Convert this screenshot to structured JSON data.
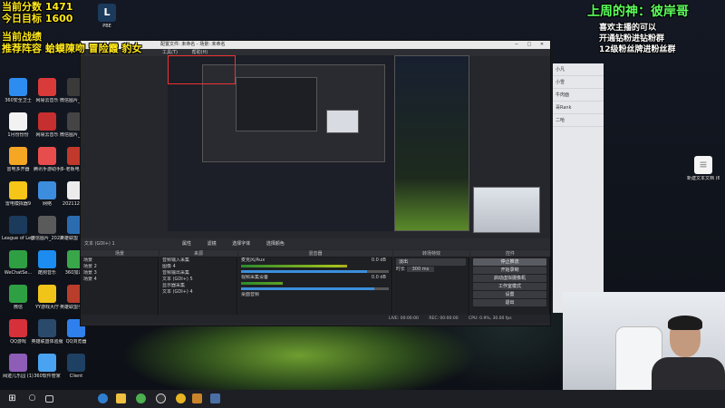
{
  "stream_overlay": {
    "score_line": "当前分数 1471",
    "goal_line": "今日目标 1600",
    "battle_line": "当前战绩",
    "recommend_line": "推荐阵容 蛤蟆陳吻 冒险霞 豹女",
    "god_line": "上周的神：彼岸哥",
    "promo": [
      "喜欢主播的可以",
      "开通钻粉进钻粉群",
      "12级粉丝牌进粉丝群"
    ]
  },
  "desktop_icons": [
    {
      "label": "360安全卫士",
      "icon": "shield-icon",
      "color": "#2d8cf0"
    },
    {
      "label": "网易云音乐",
      "icon": "music-icon",
      "color": "#d93a3a"
    },
    {
      "label": "微信图片_2022021...",
      "icon": "image-icon",
      "color": "#3a3a3a"
    },
    {
      "label": "1月份份份",
      "icon": "document-icon",
      "color": "#f2f2f2"
    },
    {
      "label": "网易云音乐",
      "icon": "netease-icon",
      "color": "#c62f2f"
    },
    {
      "label": "微信图片_2022020...",
      "icon": "image-icon",
      "color": "#444"
    },
    {
      "label": "雷电多开器",
      "icon": "thunder-icon",
      "color": "#f5a623"
    },
    {
      "label": "腾讯手游助手",
      "icon": "tencent-icon",
      "color": "#e84d4d"
    },
    {
      "label": "多·老板电竞助手",
      "icon": "gamepad-icon",
      "color": "#c0392b"
    },
    {
      "label": "雷电模拟器9",
      "icon": "android-icon",
      "color": "#f5c518"
    },
    {
      "label": "网络",
      "icon": "network-icon",
      "color": "#3c8dde"
    },
    {
      "label": "20211206...",
      "icon": "document-icon",
      "color": "#ececec"
    },
    {
      "label": "League of Legends",
      "icon": "lol-icon",
      "color": "#1b3a5c"
    },
    {
      "label": "微信图片_2022021...",
      "icon": "image-icon",
      "color": "#5a5a5a"
    },
    {
      "label": "英雄联盟 WeGame版",
      "icon": "wegame-icon",
      "color": "#2b6cb0"
    },
    {
      "label": "WeChatSe...",
      "icon": "wechat-icon",
      "color": "#2ea043"
    },
    {
      "label": "酷狗音乐",
      "icon": "kugou-icon",
      "color": "#1c8cf0"
    },
    {
      "label": "360加速球",
      "icon": "speed-icon",
      "color": "#3aa64a"
    },
    {
      "label": "微信",
      "icon": "wechat-icon",
      "color": "#2ea043"
    },
    {
      "label": "YY游戏大厅",
      "icon": "yy-icon",
      "color": "#f0c419"
    },
    {
      "label": "英雄联盟手游助手",
      "icon": "game-icon",
      "color": "#b83d2b"
    },
    {
      "label": "QQ游戏",
      "icon": "qq-game-icon",
      "color": "#d6313a"
    },
    {
      "label": "英雄联盟体验服",
      "icon": "lol-icon",
      "color": "#2a4a6b"
    },
    {
      "label": "QQ浏览器",
      "icon": "browser-icon",
      "color": "#2f80ed"
    },
    {
      "label": "阀迹儿乐园 (1)",
      "icon": "folder-icon",
      "color": "#8e5db8"
    },
    {
      "label": "360软件管家",
      "icon": "software-icon",
      "color": "#4aa3f0"
    },
    {
      "label": "Client",
      "icon": "client-icon",
      "color": "#1e4163"
    }
  ],
  "top_icon": {
    "label": "PBE"
  },
  "right_icon": {
    "label": "新建文本文档 (6)"
  },
  "obs": {
    "title": "配置文件: 未命名 - 场景: 未命名",
    "menus": [
      "工具(T)",
      "帮助(H)"
    ],
    "text_source_label": "文本 (GDI+) 1",
    "toolbar": [
      "属性",
      "滤镜",
      "选择字体",
      "选择颜色"
    ],
    "panel_headers": [
      "场景",
      "来源",
      "混音器",
      "转场特效",
      "控件"
    ],
    "scenes": [
      "场景",
      "场景 2",
      "场景 3",
      "场景 4"
    ],
    "sources": [
      "音频输入采集",
      "图像 4",
      "音频输出采集",
      "文本 (GDI+) 5",
      "显示器采集",
      "文本 (GDI+) 4"
    ],
    "mixer": [
      {
        "name": "麦克风/Aux",
        "db": "0.0 dB",
        "level": 0.72,
        "fader": 0.85
      },
      {
        "name": "视频采集设备",
        "db": "0.0 dB",
        "level": 0.28,
        "fader": 0.9
      },
      {
        "name": "桌面音频",
        "db": "",
        "level": 0.5,
        "fader": 0.8
      }
    ],
    "transition": {
      "type": "淡出",
      "duration_label": "时长",
      "duration": "300 ms"
    },
    "controls": [
      "停止推流",
      "开始录制",
      "启动虚拟摄像机",
      "工作室模式",
      "设置",
      "退出"
    ],
    "status": {
      "live": "LIVE: 00:00:00",
      "rec": "REC: 00:00:00",
      "cpu": "CPU: 0.9%, 30.00 fps"
    }
  },
  "chat_panel": {
    "items": [
      "小凡 ",
      "小雪",
      "牛肉面",
      "哥Rank",
      "二哈"
    ]
  },
  "taskbar": {
    "apps": [
      "start",
      "search",
      "taskview",
      "edge",
      "explorer",
      "obs",
      "chrome",
      "photos",
      "lol",
      "app"
    ]
  }
}
